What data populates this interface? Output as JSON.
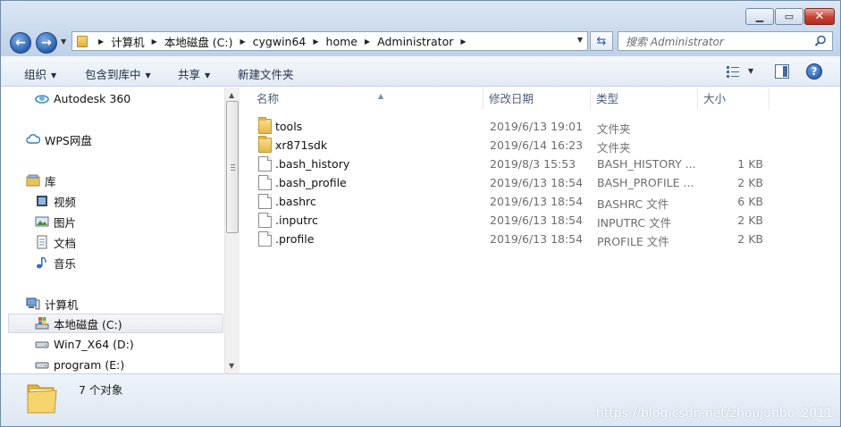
{
  "address": {
    "crumbs": [
      "计算机",
      "本地磁盘 (C:)",
      "cygwin64",
      "home",
      "Administrator"
    ]
  },
  "search": {
    "placeholder": "搜索 Administrator"
  },
  "toolbar": {
    "organize": "组织",
    "include_in_library": "包含到库中",
    "share": "共享",
    "new_folder": "新建文件夹"
  },
  "nav": {
    "autodesk": "Autodesk 360",
    "wps": "WPS网盘",
    "library": "库",
    "videos": "视频",
    "pictures": "图片",
    "documents": "文档",
    "music": "音乐",
    "computer": "计算机",
    "drive_c": "本地磁盘 (C:)",
    "drive_d": "Win7_X64 (D:)",
    "drive_e": "program (E:)"
  },
  "columns": {
    "name": "名称",
    "date": "修改日期",
    "type": "类型",
    "size": "大小"
  },
  "files": [
    {
      "name": "tools",
      "date": "2019/6/13 19:01",
      "type": "文件夹",
      "size": "",
      "icon": "folder-icon"
    },
    {
      "name": "xr871sdk",
      "date": "2019/6/14 16:23",
      "type": "文件夹",
      "size": "",
      "icon": "folder-icon"
    },
    {
      "name": ".bash_history",
      "date": "2019/8/3 15:53",
      "type": "BASH_HISTORY ...",
      "size": "1 KB",
      "icon": "file-icon"
    },
    {
      "name": ".bash_profile",
      "date": "2019/6/13 18:54",
      "type": "BASH_PROFILE ...",
      "size": "2 KB",
      "icon": "file-icon"
    },
    {
      "name": ".bashrc",
      "date": "2019/6/13 18:54",
      "type": "BASHRC 文件",
      "size": "6 KB",
      "icon": "file-icon"
    },
    {
      "name": ".inputrc",
      "date": "2019/6/13 18:54",
      "type": "INPUTRC 文件",
      "size": "2 KB",
      "icon": "file-icon"
    },
    {
      "name": ".profile",
      "date": "2019/6/13 18:54",
      "type": "PROFILE 文件",
      "size": "2 KB",
      "icon": "file-icon"
    }
  ],
  "status": {
    "count_text": "7 个对象"
  },
  "watermark": "https://blog.csdn.net/zhoujunbo_2011",
  "colors": {
    "accent": "#2a5fad",
    "folder": "#e6b746",
    "window_frame": "#c9d9ec"
  }
}
